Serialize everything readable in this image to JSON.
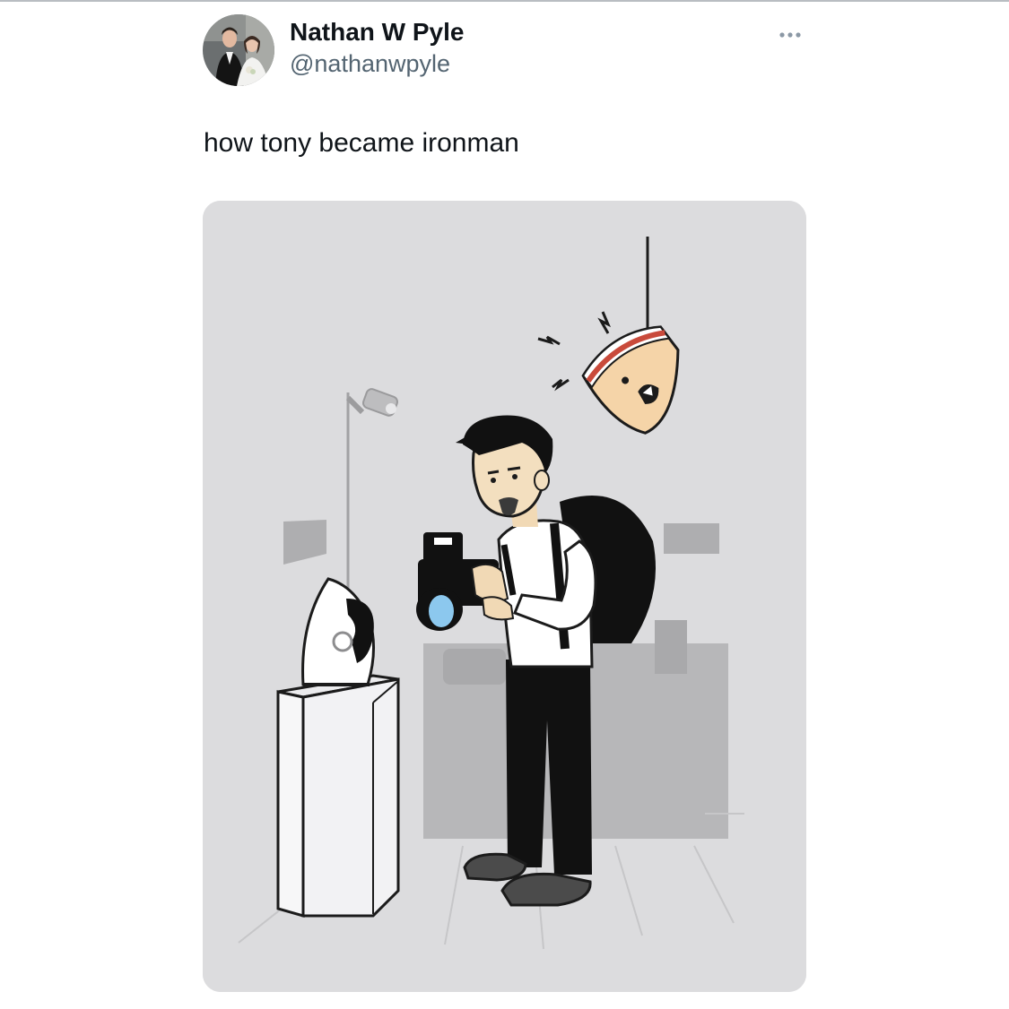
{
  "tweet": {
    "author": {
      "display_name": "Nathan W Pyle",
      "handle": "@nathanwpyle",
      "avatar_icon": "profile-photo-couple"
    },
    "text": "how tony became ironman",
    "more_icon": "more-horizontal-icon",
    "media": {
      "icon": "illustration-tourist-photographing-iron",
      "background": "#dcdcde"
    }
  },
  "colors": {
    "name_text": "#0f1419",
    "secondary_text": "#536471",
    "media_bg": "#dcdcde"
  }
}
